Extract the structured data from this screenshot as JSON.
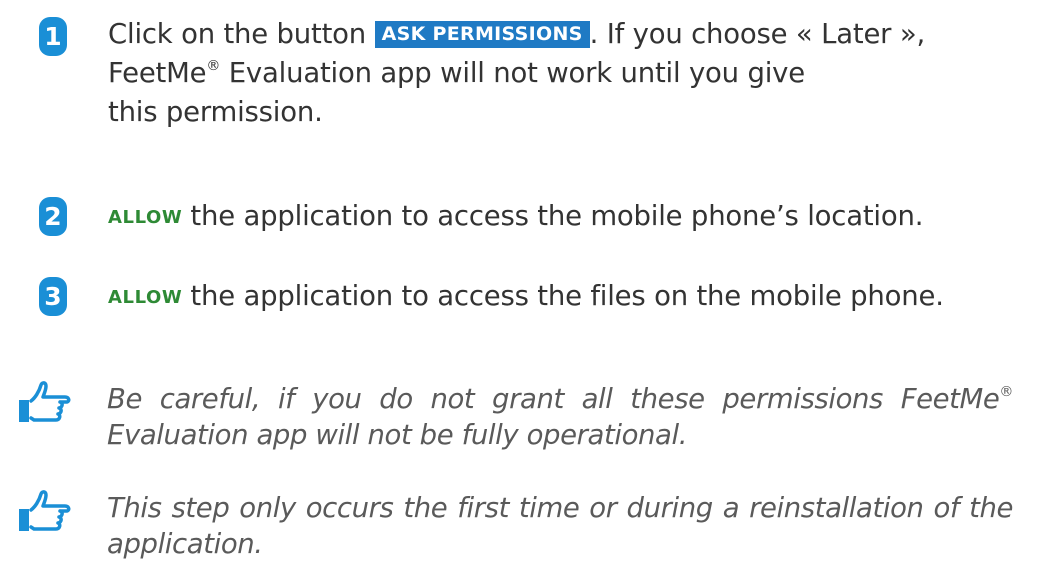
{
  "colors": {
    "step_badge": "#1a8fd6",
    "button_background": "#1f7ac4",
    "allow_text": "#2e8a35",
    "note_icon": "#1a8fd6"
  },
  "steps": [
    {
      "number": "1",
      "lines": [
        {
          "before": "Click on the button ",
          "button": "ASK PERMISSIONS",
          "after": ". If you choose « Later »,"
        },
        {
          "text_a": "FeetMe",
          "mark": "®",
          "text_b": " Evaluation app will not work until you give"
        },
        {
          "text": "this permission."
        }
      ]
    },
    {
      "number": "2",
      "allow": "ALLOW",
      "text": "the application to access the mobile phone’s location."
    },
    {
      "number": "3",
      "allow": "ALLOW",
      "text": "the application to access the files on the mobile phone."
    }
  ],
  "notes": [
    {
      "icon": "pointing-hand-icon",
      "text_a": "Be careful, if you do not grant all these permissions FeetMe",
      "mark": "®",
      "text_b": " Evaluation app will not be fully operational."
    },
    {
      "icon": "pointing-hand-icon",
      "text": "This step only occurs the first time or during a reinstallation of the application."
    }
  ]
}
